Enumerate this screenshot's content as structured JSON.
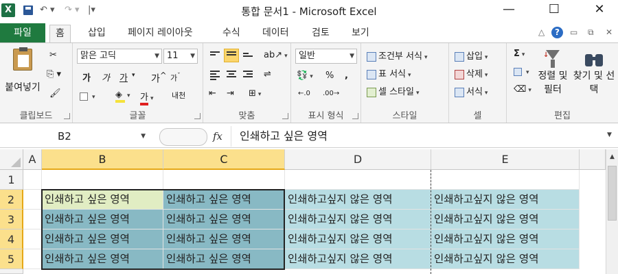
{
  "window": {
    "title": "통합 문서1 - Microsoft Excel",
    "app_logo": "X",
    "minimize": "—",
    "maximize": "☐",
    "close": "✕"
  },
  "tabs": {
    "file": "파일",
    "items": [
      "홈",
      "삽입",
      "페이지 레이아웃",
      "수식",
      "데이터",
      "검토",
      "보기"
    ],
    "active": "홈"
  },
  "ribbon": {
    "clipboard": {
      "paste": "붙여넣기",
      "label": "클립보드"
    },
    "font": {
      "name": "맑은 고딕",
      "size": "11",
      "bold": "가",
      "italic": "가",
      "underline": "가",
      "grow": "가",
      "shrink": "가",
      "font_color": "가",
      "phonetic": "내천",
      "label": "글꼴"
    },
    "alignment": {
      "label": "맞춤"
    },
    "number": {
      "format": "일반",
      "percent": "%",
      "comma": ",",
      "label": "표시 형식"
    },
    "styles": {
      "conditional": "조건부 서식",
      "table": "표 서식",
      "cell_style": "셀 스타일",
      "label": "스타일"
    },
    "cells": {
      "insert": "삽입",
      "delete": "삭제",
      "format": "서식",
      "label": "셀"
    },
    "editing": {
      "sigma": "Σ",
      "sort_filter": "정렬 및 필터",
      "find_select": "찾기 및 선택",
      "label": "편집"
    }
  },
  "formula_bar": {
    "name_box": "B2",
    "fx": "fx",
    "content": "인쇄하고 싶은 영역"
  },
  "sheet": {
    "columns": [
      "A",
      "B",
      "C",
      "D",
      "E"
    ],
    "rows": [
      "1",
      "2",
      "3",
      "4",
      "5"
    ],
    "print_text": "인쇄하고 싶은 영역",
    "nonprint_text": "인쇄하고싶지 않은 영역",
    "selection": "B2:C5",
    "colors": {
      "print_area": "#88b9c4",
      "nonprint_area": "#b8dde3",
      "active_cell": "#e1edc3",
      "header_highlight": "#fbe08c",
      "file_tab": "#1f7a3f"
    }
  }
}
